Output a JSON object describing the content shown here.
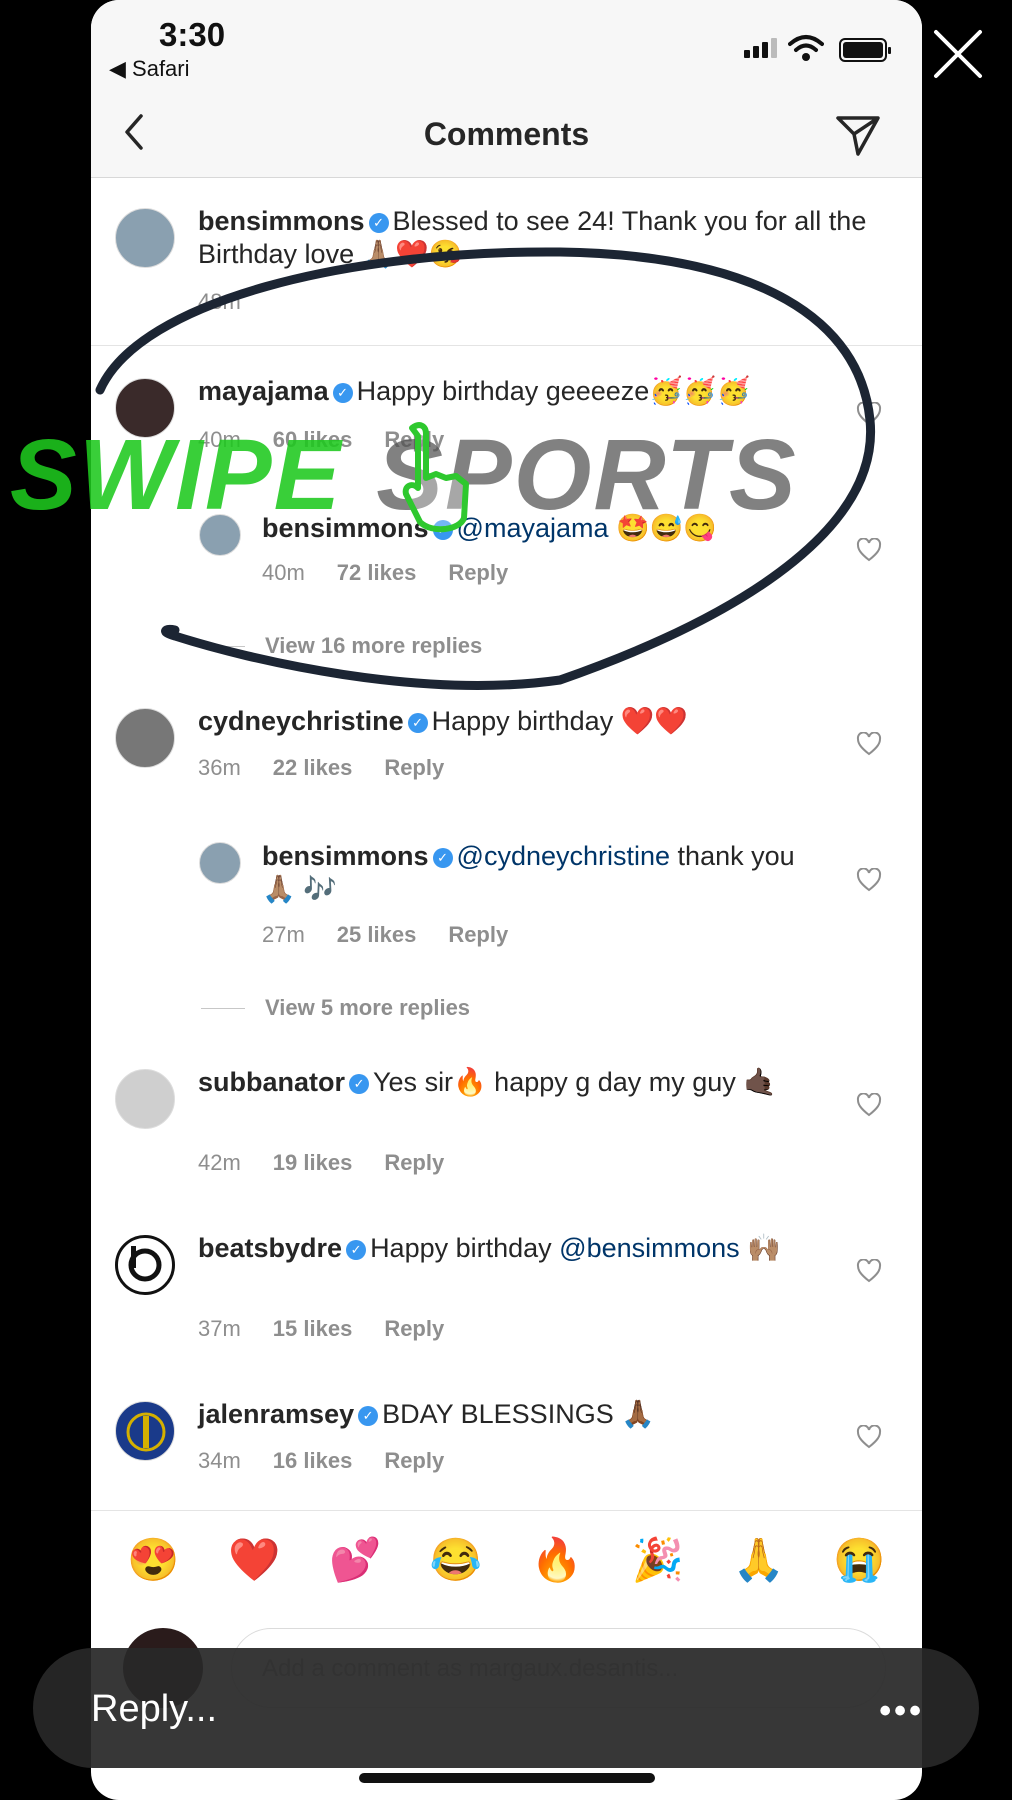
{
  "status_bar": {
    "time": "3:30",
    "back_app": "◀ Safari"
  },
  "header": {
    "title": "Comments"
  },
  "comments": [
    {
      "username": "bensimmons",
      "text": "Blessed to see 24! Thank you for all the Birthday love 🙏🏽❤️😘",
      "time": "48m",
      "avatar_color": "#8aa0b0"
    },
    {
      "username": "mayajama",
      "text": "Happy birthday geeeeze🥳🥳🥳",
      "time": "40m",
      "likes": "60 likes",
      "reply": "Reply",
      "avatar_color": "#3a2a2a"
    },
    {
      "username": "bensimmons",
      "mention": "@mayajama",
      "text": " 🤩😅😋",
      "time": "40m",
      "likes": "72 likes",
      "reply": "Reply",
      "avatar_color": "#8aa0b0"
    },
    {
      "username": "cydneychristine",
      "text": "Happy birthday ❤️❤️",
      "time": "36m",
      "likes": "22 likes",
      "reply": "Reply",
      "avatar_color": "#777"
    },
    {
      "username": "bensimmons",
      "mention": "@cydneychristine",
      "text": " thank you 🙏🏽 🎶",
      "time": "27m",
      "likes": "25 likes",
      "reply": "Reply",
      "avatar_color": "#8aa0b0"
    },
    {
      "username": "subbanator",
      "text": "Yes sir🔥  happy g day my guy 🤙🏿",
      "time": "42m",
      "likes": "19 likes",
      "reply": "Reply",
      "avatar_color": "#ccc"
    },
    {
      "username": "beatsbydre",
      "text": "Happy birthday ",
      "mention": "@bensimmons",
      "text2": " 🙌🏽",
      "time": "37m",
      "likes": "15 likes",
      "reply": "Reply",
      "avatar_color": "#fff"
    },
    {
      "username": "jalenramsey",
      "text": "BDAY BLESSINGS 🙏🏾",
      "time": "34m",
      "likes": "16 likes",
      "reply": "Reply",
      "avatar_color": "#1a3a8a"
    }
  ],
  "view_more": [
    "View 16 more replies",
    "View 5 more replies"
  ],
  "emoji_bar": [
    "😍",
    "❤️",
    "💕",
    "😂",
    "🔥",
    "🎉",
    "🙏",
    "😭"
  ],
  "comment_input": {
    "placeholder": "Add a comment as margaux.desantis..."
  },
  "watermark": {
    "part1": "SWIPE",
    "part2": "SPORTS"
  },
  "reply_bar": {
    "label": "Reply...",
    "more": "•••"
  },
  "colors": {
    "accent": "#3897f0",
    "mention": "#003569",
    "watermark_green": "#1ec81e"
  }
}
